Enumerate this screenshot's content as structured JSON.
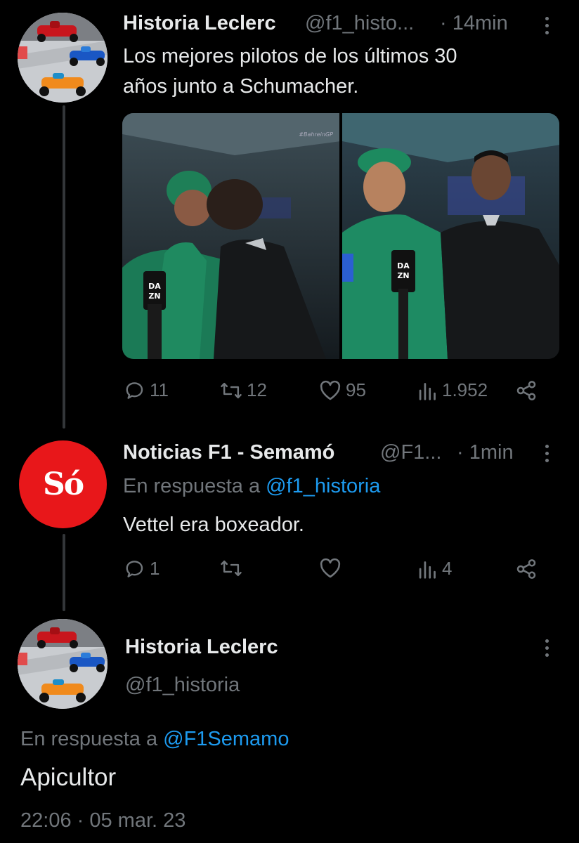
{
  "tweet1": {
    "author_name": "Historia Leclerc",
    "author_handle": "@f1_histo...",
    "time": "· 14min",
    "text_line1": "Los mejores pilotos de los últimos 30",
    "text_line2": "años junto a Schumacher.",
    "media_watermark": "#BahreinGP",
    "mic_label": "DA ZN",
    "stats": {
      "replies": "11",
      "retweets": "12",
      "likes": "95",
      "views": "1.952"
    }
  },
  "tweet2": {
    "author_name": "Noticias F1 - Semamó",
    "author_handle": "@F1...",
    "time": "· 1min",
    "avatar_text": "Só",
    "reply_prefix": "En respuesta a",
    "reply_handle": "@f1_historia",
    "text": "Vettel era boxeador.",
    "stats": {
      "replies": "1",
      "views": "4"
    }
  },
  "tweet3": {
    "author_name": "Historia Leclerc",
    "author_handle": "@f1_historia",
    "reply_prefix": "En respuesta a",
    "reply_handle": "@F1Semamo",
    "text": "Apicultor",
    "timestamp": "22:06 · 05 mar. 23"
  },
  "colors": {
    "background": "#000000",
    "text": "#e7e9ea",
    "muted": "#71767b",
    "link": "#1d9bf0",
    "semamo_red": "#e8171a"
  },
  "icons": [
    "reply-icon",
    "retweet-icon",
    "like-icon",
    "views-icon",
    "share-icon",
    "more-icon"
  ]
}
